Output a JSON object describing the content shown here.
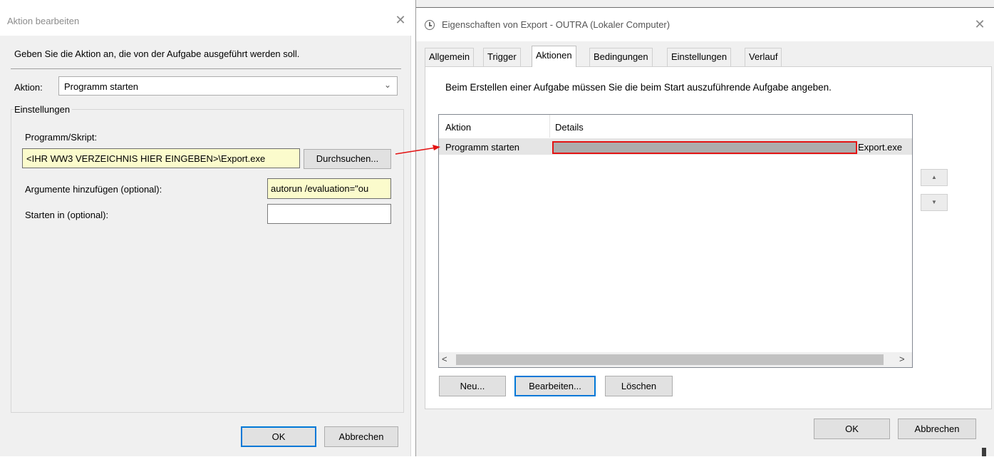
{
  "left_dialog": {
    "title": "Aktion bearbeiten",
    "close_glyph": "✕",
    "instruction": "Geben Sie die Aktion an, die von der Aufgabe ausgeführt werden soll.",
    "action_label": "Aktion:",
    "action_value": "Programm starten",
    "settings_legend": "Einstellungen",
    "program_label": "Programm/Skript:",
    "program_value": "<IHR WW3 VERZEICHNIS HIER EINGEBEN>\\Export.exe",
    "browse_label": "Durchsuchen...",
    "args_label": "Argumente hinzufügen (optional):",
    "args_value": "autorun /evaluation=\"ou",
    "startin_label": "Starten in (optional):",
    "startin_value": "",
    "ok_label": "OK",
    "cancel_label": "Abbrechen"
  },
  "right_dialog": {
    "title": "Eigenschaften von Export - OUTRA (Lokaler Computer)",
    "close_glyph": "✕",
    "tabs": [
      {
        "label": "Allgemein",
        "active": false
      },
      {
        "label": "Trigger",
        "active": false
      },
      {
        "label": "Aktionen",
        "active": true
      },
      {
        "label": "Bedingungen",
        "active": false
      },
      {
        "label": "Einstellungen",
        "active": false
      },
      {
        "label": "Verlauf",
        "active": false
      }
    ],
    "instruction": "Beim Erstellen einer Aufgabe müssen Sie die beim Start auszuführende Aufgabe angeben.",
    "columns": [
      "Aktion",
      "Details"
    ],
    "rows": [
      {
        "action": "Programm starten",
        "details_tail": "Export.exe"
      }
    ],
    "scroll_left_glyph": "<",
    "scroll_right_glyph": ">",
    "move_up_glyph": "▲",
    "move_down_glyph": "▼",
    "new_label": "Neu...",
    "edit_label": "Bearbeiten...",
    "delete_label": "Löschen",
    "ok_label": "OK",
    "cancel_label": "Abbrechen"
  },
  "colors": {
    "dialog_bg": "#f0f0f0",
    "highlight_input": "#fbfbcc",
    "focus_blue": "#0078d7",
    "annotation_red": "#e31313"
  },
  "icons": [
    "close-icon",
    "chevron-down-icon",
    "clock-icon",
    "arrow-annotation-icon",
    "move-up-icon",
    "move-down-icon"
  ]
}
